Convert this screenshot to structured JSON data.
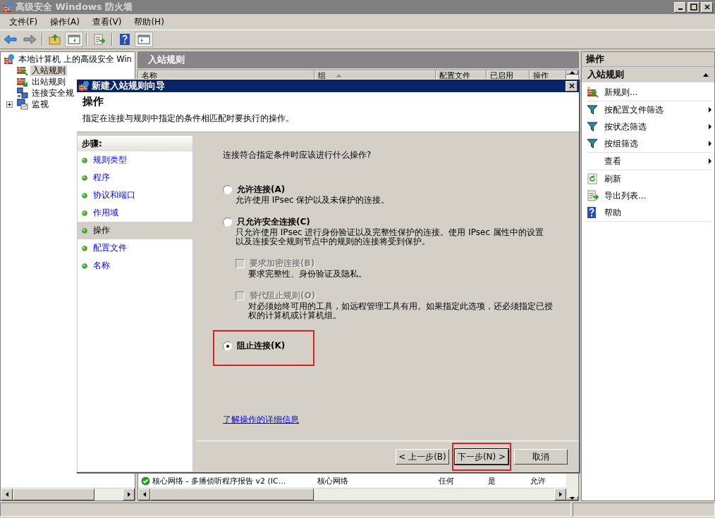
{
  "window": {
    "title": "高级安全 Windows 防火墙"
  },
  "menu": [
    "文件(F)",
    "操作(A)",
    "查看(V)",
    "帮助(H)"
  ],
  "tree": [
    {
      "label": "本地计算机 上的高级安全 Win",
      "kind": "root",
      "selected": false,
      "children": [
        {
          "label": "入站规则",
          "kind": "inbound",
          "selected": true
        },
        {
          "label": "出站规则",
          "kind": "outbound",
          "selected": false
        },
        {
          "label": "连接安全规",
          "kind": "security",
          "selected": false
        },
        {
          "label": "监视",
          "kind": "monitor",
          "selected": false,
          "expanded": false
        }
      ]
    }
  ],
  "center": {
    "title": "入站规则",
    "columns": [
      {
        "label": "名称",
        "sorted": false
      },
      {
        "label": "组",
        "sorted": true
      },
      {
        "label": "配置文件",
        "sorted": false
      },
      {
        "label": "已启用",
        "sorted": false
      },
      {
        "label": "操作",
        "sorted": false
      }
    ],
    "rows": [
      {
        "enabled": true,
        "cells": [
          "核心网络 - 多播侦听程序报告 v2 (IC...",
          "核心网络",
          "任何",
          "是",
          "允许"
        ]
      }
    ]
  },
  "actions": {
    "title": "操作",
    "section": "入站规则",
    "items": [
      {
        "label": "新规则...",
        "kind": "new-rule",
        "submenu": false
      },
      {
        "label": "按配置文件筛选",
        "kind": "filter",
        "submenu": true
      },
      {
        "label": "按状态筛选",
        "kind": "filter",
        "submenu": true
      },
      {
        "label": "按组筛选",
        "kind": "filter",
        "submenu": true
      },
      {
        "label": "查看",
        "kind": "none",
        "submenu": true
      },
      {
        "label": "刷新",
        "kind": "refresh",
        "submenu": false
      },
      {
        "label": "导出列表...",
        "kind": "export",
        "submenu": false
      },
      {
        "label": "帮助",
        "kind": "help",
        "submenu": false
      }
    ]
  },
  "dialog": {
    "title": "新建入站规则向导",
    "heading": "操作",
    "description": "指定在连接与规则中指定的条件相匹配时要执行的操作。",
    "steps_title": "步骤:",
    "steps": [
      {
        "label": "规则类型",
        "selected": false
      },
      {
        "label": "程序",
        "selected": false
      },
      {
        "label": "协议和端口",
        "selected": false
      },
      {
        "label": "作用域",
        "selected": false
      },
      {
        "label": "操作",
        "selected": true
      },
      {
        "label": "配置文件",
        "selected": false
      },
      {
        "label": "名称",
        "selected": false
      }
    ],
    "question": "连接符合指定条件时应该进行什么操作?",
    "options": [
      {
        "kind": "radio",
        "label": "允许连接(A)",
        "description": "允许使用 IPsec 保护以及未保护的连接。",
        "selected": false,
        "highlighted": false
      },
      {
        "kind": "radio",
        "label": "只允许安全连接(C)",
        "description": "只允许使用 IPsec 进行身份验证以及完整性保护的连接。使用 IPsec 属性中的设置以及连接安全规则节点中的规则的连接将受到保护。",
        "selected": false,
        "highlighted": false
      },
      {
        "kind": "checkbox",
        "label": "要求加密连接(B)",
        "description": "要求完整性、身份验证及隐私。",
        "checked": false,
        "disabled": true
      },
      {
        "kind": "checkbox",
        "label": "替代阻止规则(O)",
        "description": "对必须始终可用的工具，如远程管理工具有用。如果指定此选项，还必须指定已授权的计算机或计算机组。",
        "checked": false,
        "disabled": true
      },
      {
        "kind": "radio",
        "label": "阻止连接(K)",
        "selected": true,
        "highlighted": true
      }
    ],
    "link": "了解操作的详细信息",
    "buttons": [
      {
        "label": "< 上一步(B)",
        "highlighted": false
      },
      {
        "label": "下一步(N) >",
        "highlighted": true
      },
      {
        "label": "取消",
        "highlighted": false
      }
    ]
  }
}
